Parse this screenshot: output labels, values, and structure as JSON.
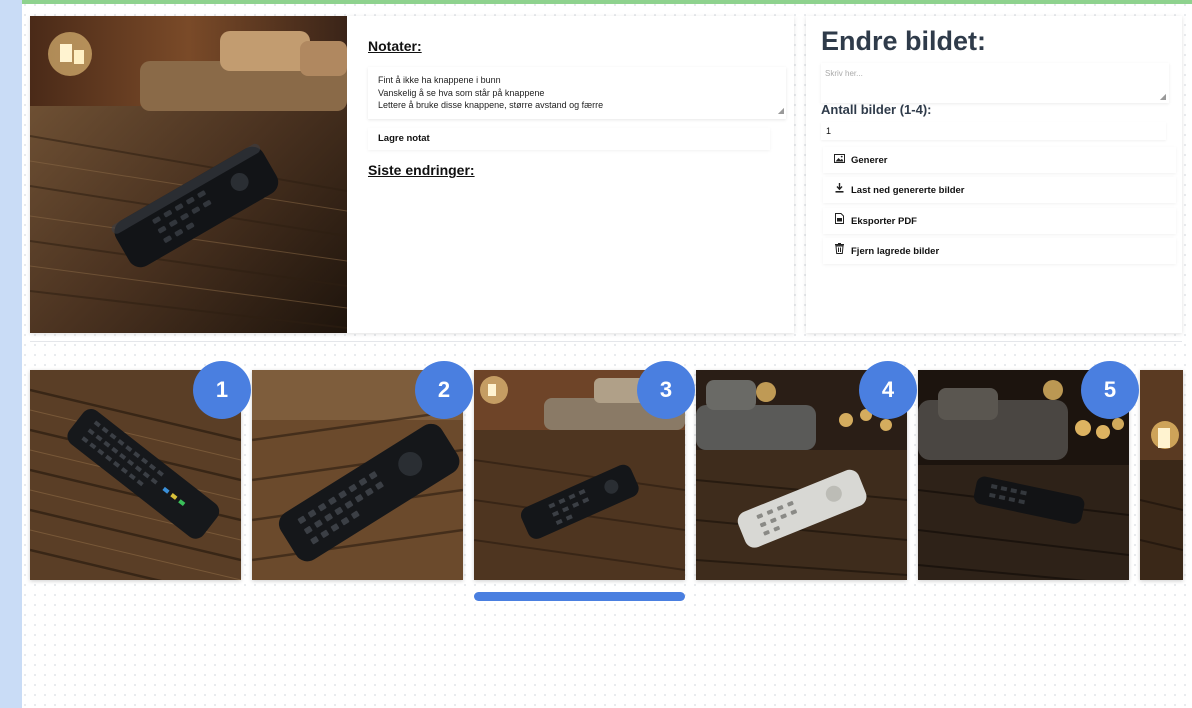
{
  "notes": {
    "heading": "Notater:",
    "lines": [
      "Fint å ikke ha knappene i bunn",
      "Vanskelig å se hva som står på knappene",
      "Lettere å bruke disse knappene, større avstand og færre"
    ],
    "save_label": "Lagre notat"
  },
  "changes": {
    "heading": "Siste endringer:"
  },
  "edit_panel": {
    "title": "Endre bildet:",
    "prompt_placeholder": "Skriv her...",
    "count_label": "Antall bilder (1-4):",
    "count_value": "1",
    "buttons": [
      {
        "icon": "image-icon",
        "label": "Generer"
      },
      {
        "icon": "download-icon",
        "label": "Last ned genererte bilder"
      },
      {
        "icon": "pdf-file-icon",
        "label": "Eksporter PDF"
      },
      {
        "icon": "trash-icon",
        "label": "Fjern lagrede bilder"
      }
    ]
  },
  "gallery": {
    "badges": [
      "1",
      "2",
      "3",
      "4",
      "5"
    ],
    "selected_index": 3
  },
  "colors": {
    "accent": "#4a7fe0",
    "heading": "#2f3b4a",
    "top_accent": "#8ed28e",
    "left_rail": "#c9dcf6"
  }
}
